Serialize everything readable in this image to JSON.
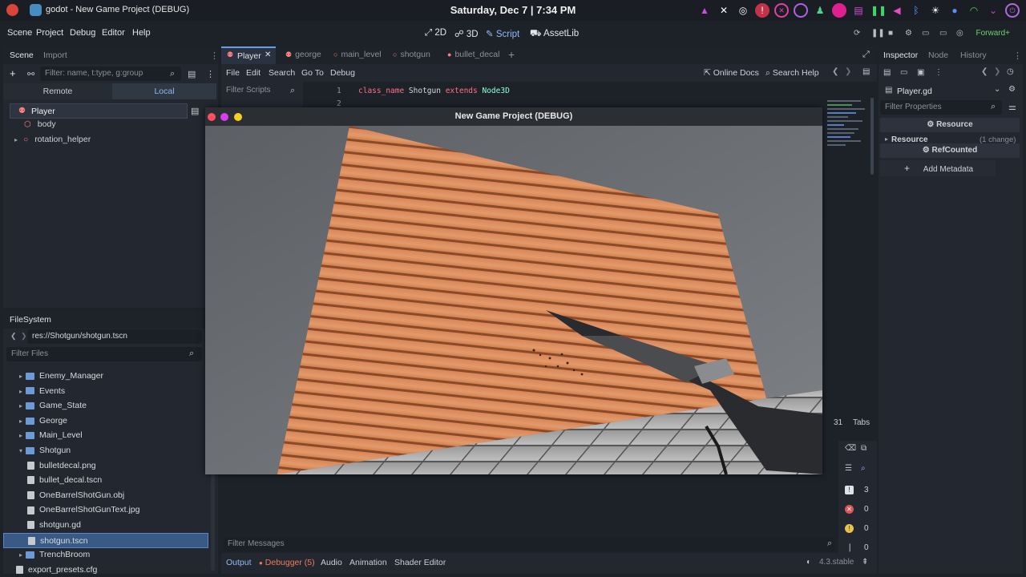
{
  "system": {
    "app_name": "godot",
    "window_title": "godot - New Game Project (DEBUG)",
    "clock": "Saturday, Dec 7 | 7:34 PM"
  },
  "menu": [
    "Scene",
    "Project",
    "Debug",
    "Editor",
    "Help"
  ],
  "workspaces": {
    "d2": "2D",
    "d3": "3D",
    "script": "Script",
    "assetlib": "AssetLib"
  },
  "renderer": "Forward+",
  "scene_dock": {
    "tabs": [
      "Scene",
      "Import"
    ],
    "filter_placeholder": "Filter: name, t:type, g:group",
    "remote": "Remote",
    "local": "Local",
    "nodes": [
      "Player",
      "body",
      "rotation_helper"
    ]
  },
  "filesystem": {
    "title": "FileSystem",
    "path": "res://Shotgun/shotgun.tscn",
    "filter_placeholder": "Filter Files",
    "items": [
      {
        "name": "Enemy_Manager",
        "type": "folder",
        "indent": 1
      },
      {
        "name": "Events",
        "type": "folder",
        "indent": 1
      },
      {
        "name": "Game_State",
        "type": "folder",
        "indent": 1
      },
      {
        "name": "George",
        "type": "folder",
        "indent": 1
      },
      {
        "name": "Main_Level",
        "type": "folder",
        "indent": 1
      },
      {
        "name": "Shotgun",
        "type": "folder-open",
        "indent": 1
      },
      {
        "name": "bulletdecal.png",
        "type": "file",
        "indent": 2
      },
      {
        "name": "bullet_decal.tscn",
        "type": "file",
        "indent": 2
      },
      {
        "name": "OneBarrelShotGun.obj",
        "type": "file",
        "indent": 2
      },
      {
        "name": "OneBarrelShotGunText.jpg",
        "type": "file",
        "indent": 2
      },
      {
        "name": "shotgun.gd",
        "type": "file",
        "indent": 2
      },
      {
        "name": "shotgun.tscn",
        "type": "file",
        "indent": 2,
        "selected": true
      },
      {
        "name": "TrenchBroom",
        "type": "folder",
        "indent": 1
      },
      {
        "name": "export_presets.cfg",
        "type": "file",
        "indent": 1
      }
    ]
  },
  "script_tabs": [
    "Player",
    "george",
    "main_level",
    "shotgun",
    "bullet_decal"
  ],
  "script_menu": [
    "File",
    "Edit",
    "Search",
    "Go To",
    "Debug"
  ],
  "online_docs": "Online Docs",
  "search_help": "Search Help",
  "filter_scripts": "Filter Scripts",
  "code": [
    {
      "line": "1",
      "text": "class_name Shotgun extends Node3D"
    },
    {
      "line": "2",
      "text": ""
    }
  ],
  "game_window": {
    "title": "New Game Project (DEBUG)"
  },
  "status": {
    "col": "31",
    "tabs": "Tabs"
  },
  "inspector": {
    "tabs": [
      "Inspector",
      "Node",
      "History"
    ],
    "resource_name": "Player.gd",
    "filter_placeholder": "Filter Properties",
    "section": "Resource",
    "subsection": "Resource",
    "change": "(1 change)",
    "refcounted": "RefCounted",
    "add_metadata": "Add Metadata"
  },
  "output": {
    "filter_placeholder": "Filter Messages",
    "counts": [
      "3",
      "0",
      "0",
      "0"
    ]
  },
  "bottom_tabs": [
    "Output",
    "Debugger (5)",
    "Audio",
    "Animation",
    "Shader Editor"
  ],
  "version": "4.3.stable"
}
